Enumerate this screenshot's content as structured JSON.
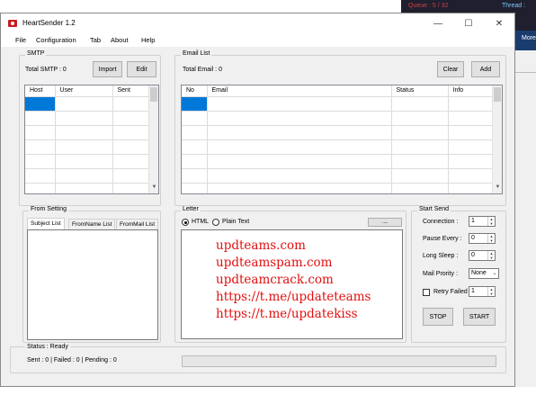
{
  "background": {
    "queue_text": "Queue : 5 / 32",
    "thread_text": "Thread :",
    "more_label": "More"
  },
  "window": {
    "title": "HeartSender 1.2",
    "minimize": "—",
    "maximize": "☐",
    "close": "✕"
  },
  "menu": [
    "File",
    "Configuration",
    "Tab",
    "About",
    "Help"
  ],
  "smtp": {
    "group_title": "SMTP",
    "total_label": "Total SMTP : 0",
    "import_label": "Import",
    "edit_label": "Edit",
    "columns": [
      "Host",
      "User",
      "Sent"
    ]
  },
  "email_list": {
    "group_title": "Email List",
    "total_label": "Total Email : 0",
    "clear_label": "Clear",
    "add_label": "Add",
    "columns": [
      "No",
      "Email",
      "Status",
      "Info"
    ]
  },
  "from_setting": {
    "group_title": "From Setting",
    "tabs": [
      "Subject List",
      "FromName List",
      "FromMail List"
    ]
  },
  "letter": {
    "group_title": "Letter",
    "html_label": "HTML",
    "plain_label": "Plain Text",
    "browse_label": "....",
    "lines": [
      "updteams.com",
      "updteamspam.com",
      "updteamcrack.com",
      "https://t.me/updateteams",
      "https://t.me/updatekiss"
    ],
    "text_color": "#e01010"
  },
  "start_send": {
    "group_title": "Start Send",
    "connection_label": "Connection :",
    "connection_value": "1",
    "pause_label": "Pause Every :",
    "pause_value": "0",
    "long_sleep_label": "Long Sleep :",
    "long_sleep_value": "0",
    "priority_label": "Mail Prority :",
    "priority_value": "None",
    "retry_label": "Retry Failed",
    "retry_value": "1",
    "stop_label": "STOP",
    "start_label": "START"
  },
  "status": {
    "status_label": "Status : Ready",
    "counts_label": "Sent : 0 | Failed : 0 | Pending : 0",
    "progress": 0
  }
}
